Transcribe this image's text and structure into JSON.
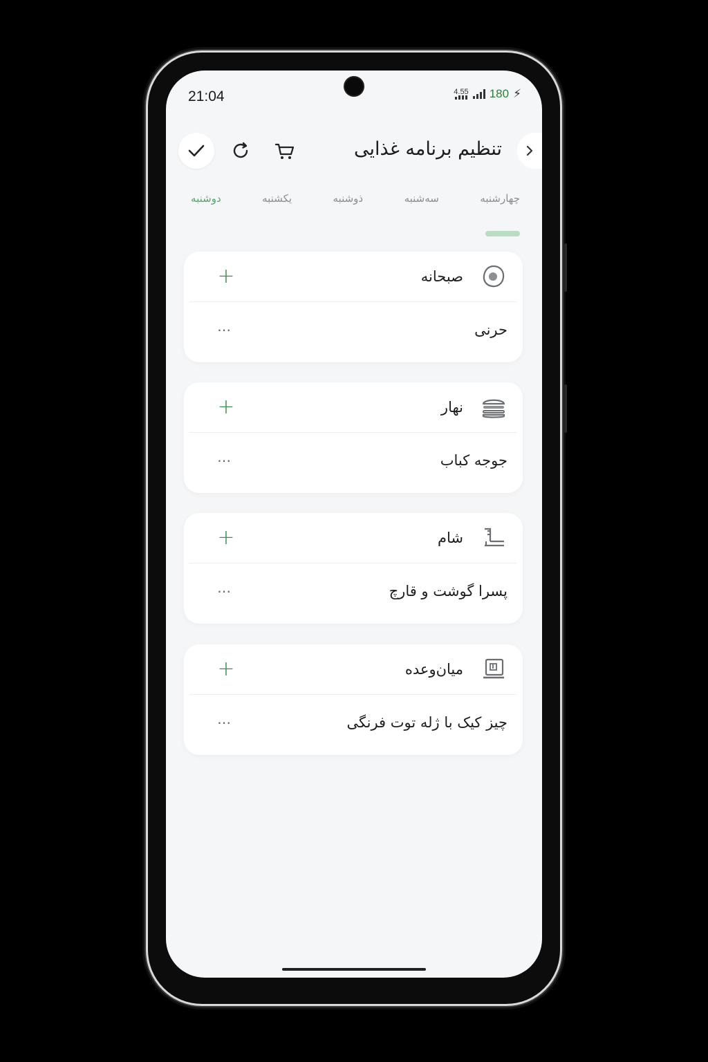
{
  "status_bar": {
    "time": "21:04",
    "net_speed": "4.55",
    "battery": "180"
  },
  "header": {
    "title": "تنظیم برنامه غذایی",
    "icons": {
      "confirm": "check-icon",
      "refresh": "refresh-icon",
      "cart": "cart-icon",
      "back": "chevron-right-icon"
    }
  },
  "tabs": [
    {
      "label": "دوشنبه",
      "active": true
    },
    {
      "label": "یکشنبه",
      "active": false
    },
    {
      "label": "ذوشنبه",
      "active": false
    },
    {
      "label": "سه‌شنبه",
      "active": false
    },
    {
      "label": "چهارشنبه",
      "active": false
    }
  ],
  "meals": [
    {
      "name": "صبحانه",
      "icon": "egg-icon",
      "food": "حرنی"
    },
    {
      "name": "نهار",
      "icon": "burger-icon",
      "food": "جوجه کباب"
    },
    {
      "name": "شام",
      "icon": "dinner-icon",
      "food": "پسرا گوشت و قارچ"
    },
    {
      "name": "میان‌وعده",
      "icon": "snack-icon",
      "food": "چیز کیک با ژله توت فرنگی"
    }
  ],
  "colors": {
    "accent": "#3f8f4e",
    "tab_active": "#5aa56a",
    "indicator": "#b8ddbf",
    "battery": "#2f7d3a"
  }
}
